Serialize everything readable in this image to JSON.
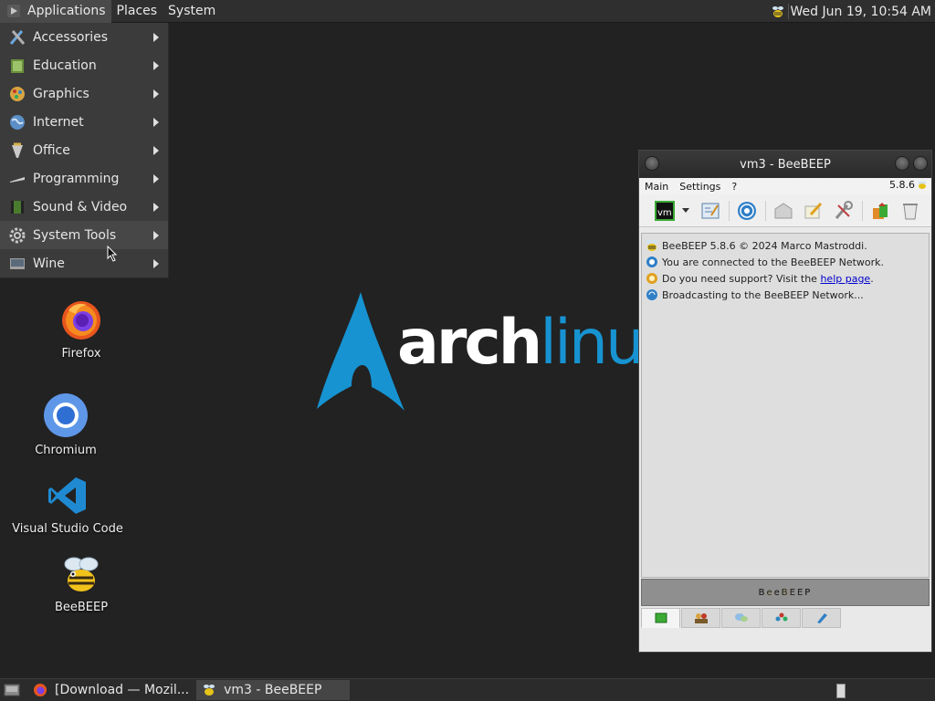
{
  "top_panel": {
    "menus": [
      "Applications",
      "Places",
      "System"
    ],
    "clock": "Wed Jun 19, 10:54 AM"
  },
  "apps_menu": {
    "items": [
      {
        "label": "Accessories",
        "icon": "accessories-icon"
      },
      {
        "label": "Education",
        "icon": "education-icon"
      },
      {
        "label": "Graphics",
        "icon": "graphics-icon"
      },
      {
        "label": "Internet",
        "icon": "internet-icon"
      },
      {
        "label": "Office",
        "icon": "office-icon"
      },
      {
        "label": "Programming",
        "icon": "programming-icon"
      },
      {
        "label": "Sound & Video",
        "icon": "sound-video-icon"
      },
      {
        "label": "System Tools",
        "icon": "system-tools-icon"
      },
      {
        "label": "Wine",
        "icon": "wine-icon"
      }
    ],
    "hovered": "System Tools"
  },
  "desktop_icons": [
    {
      "label": "Firefox",
      "icon": "firefox-icon"
    },
    {
      "label": "Chromium",
      "icon": "chromium-icon"
    },
    {
      "label": "Visual Studio Code",
      "icon": "vscode-icon"
    },
    {
      "label": "BeeBEEP",
      "icon": "beebeep-icon"
    }
  ],
  "arch_logo": {
    "bold": "arch",
    "light": "linux"
  },
  "beebeep": {
    "title": "vm3 - BeeBEEP",
    "menu": [
      "Main",
      "Settings",
      "?"
    ],
    "version": "5.8.6",
    "chat_lines": {
      "l1": "BeeBEEP 5.8.6 © 2024 Marco Mastroddi.",
      "l2": "You are connected to the BeeBEEP Network.",
      "l3_prefix": "Do you need support? Visit the ",
      "l3_link": "help page",
      "l3_suffix": ".",
      "l4": "Broadcasting to the BeeBEEP Network..."
    },
    "bar_text": "BeeBEEP",
    "accent_color": "#1793d1"
  },
  "taskbar": {
    "tasks": [
      "[Download — Mozil...",
      "vm3 - BeeBEEP"
    ]
  }
}
